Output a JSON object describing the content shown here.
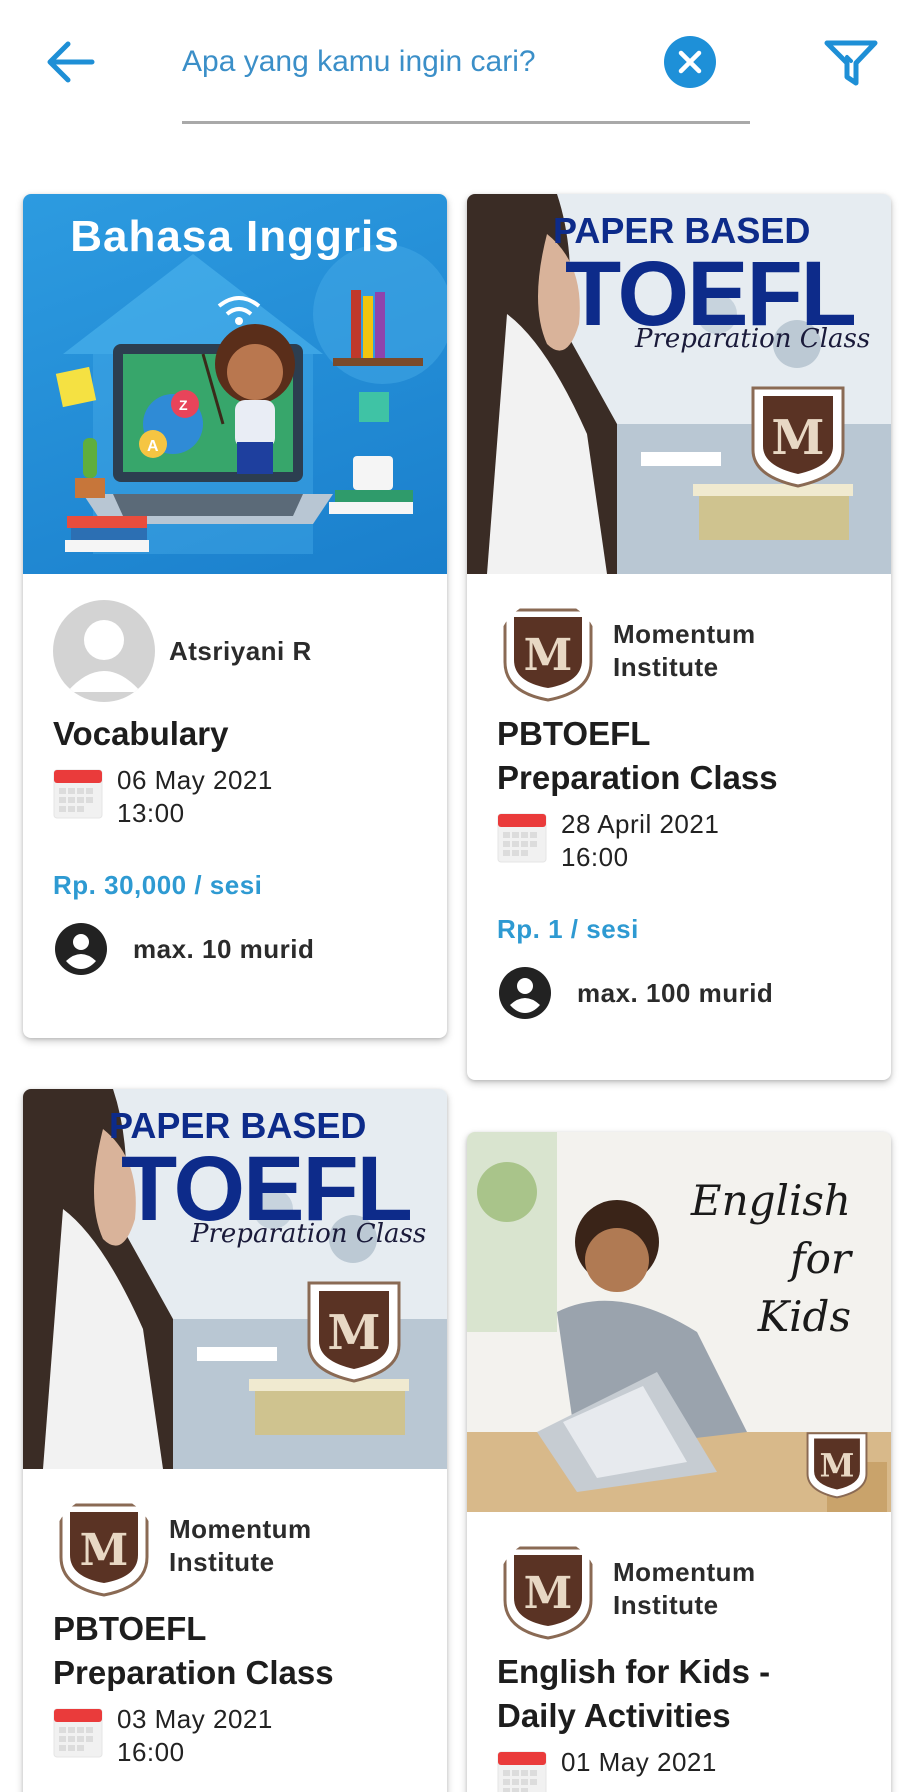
{
  "search": {
    "placeholder": "Apa yang kamu ingin cari?",
    "value": ""
  },
  "icons": {
    "back": "arrow-left-icon",
    "clear": "close-circle-icon",
    "filter": "filter-funnel-icon",
    "calendar": "calendar-icon",
    "capacity": "account-circle-icon"
  },
  "colors": {
    "accent": "#1e90d8",
    "price": "#2e9ad2",
    "brand_blue": "#0d2b8a",
    "momentum_brown": "#5a3324"
  },
  "cards": [
    {
      "thumb_text": "Bahasa Inggris",
      "owner": "Atsriyani  R",
      "title": "Vocabulary",
      "date": "06 May 2021",
      "time": "13:00",
      "price": "Rp. 30,000 / sesi",
      "capacity": "max. 10 murid"
    },
    {
      "thumb_line1": "PAPER BASED",
      "thumb_line2": "TOEFL",
      "thumb_line3": "Preparation Class",
      "owner_line1": "Momentum",
      "owner_line2": "Institute",
      "title_line1": "PBTOEFL",
      "title_line2": "Preparation Class",
      "date": "28 April 2021",
      "time": "16:00",
      "price": "Rp. 1 / sesi",
      "capacity": "max. 100 murid"
    },
    {
      "thumb_line1": "PAPER BASED",
      "thumb_line2": "TOEFL",
      "thumb_line3": "Preparation Class",
      "owner_line1": "Momentum",
      "owner_line2": "Institute",
      "title_line1": "PBTOEFL",
      "title_line2": "Preparation Class",
      "date": "03 May 2021",
      "time": "16:00"
    },
    {
      "thumb_line1": "English",
      "thumb_line2": "for",
      "thumb_line3": "Kids",
      "owner_line1": "Momentum",
      "owner_line2": "Institute",
      "title_line1": "English for Kids -",
      "title_line2": "Daily Activities",
      "date": "01 May 2021"
    }
  ]
}
